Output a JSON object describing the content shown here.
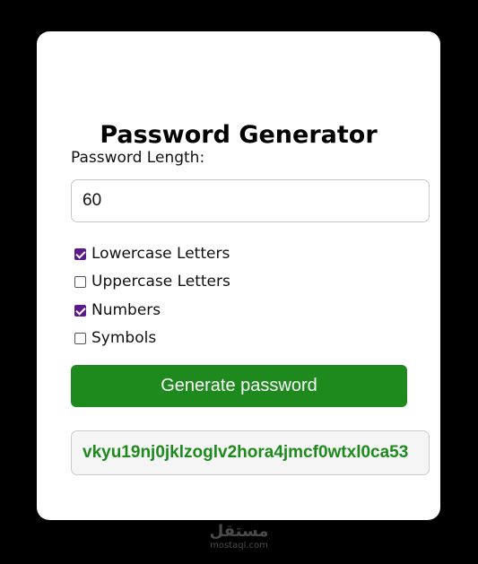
{
  "card": {
    "title": "Password Generator",
    "length_label": "Password Length:",
    "length_value": "60",
    "options": [
      {
        "label": "Lowercase Letters",
        "checked": true
      },
      {
        "label": "Uppercase Letters",
        "checked": false
      },
      {
        "label": "Numbers",
        "checked": true
      },
      {
        "label": "Symbols",
        "checked": false
      }
    ],
    "generate_label": "Generate password",
    "result": "vkyu19nj0jklzoglv2hora4jmcf0wtxl0ca53"
  },
  "colors": {
    "button_green": "#1e8a1e",
    "result_green": "#1e8a1e",
    "checkbox_purple": "#5c1a8c"
  },
  "watermark": {
    "brand": "مستقل",
    "site": "mostaql.com"
  }
}
